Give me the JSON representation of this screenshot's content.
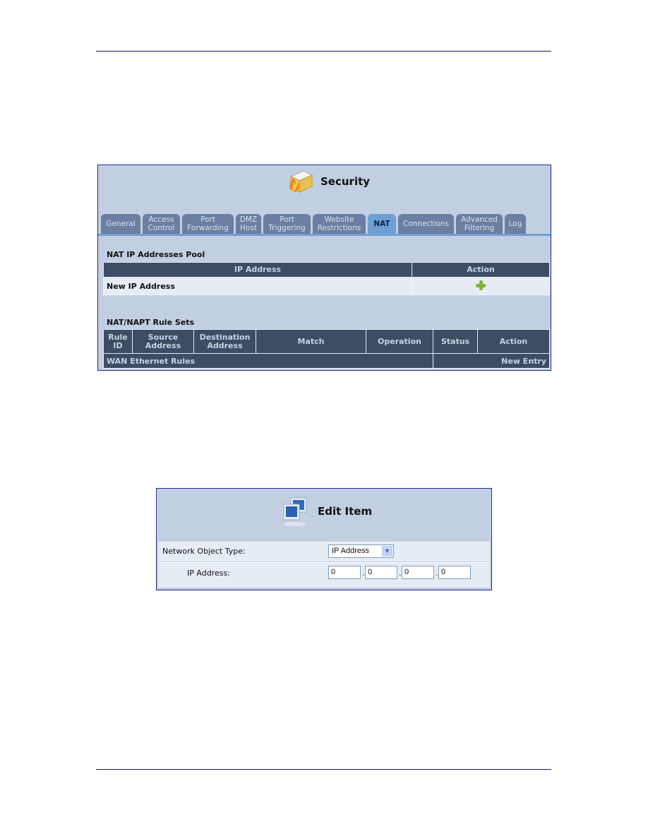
{
  "security": {
    "title": "Security",
    "icon": "firewall-icon",
    "tabs": [
      {
        "label": "General",
        "active": false
      },
      {
        "label": "Access Control",
        "active": false
      },
      {
        "label": "Port Forwarding",
        "active": false
      },
      {
        "label": "DMZ Host",
        "active": false
      },
      {
        "label": "Port Triggering",
        "active": false
      },
      {
        "label": "Website Restrictions",
        "active": false
      },
      {
        "label": "NAT",
        "active": true
      },
      {
        "label": "Connections",
        "active": false
      },
      {
        "label": "Advanced Filtering",
        "active": false
      },
      {
        "label": "Log",
        "active": false
      }
    ],
    "pool": {
      "title": "NAT IP Addresses Pool",
      "columns": [
        "IP Address",
        "Action"
      ],
      "new_row_label": "New IP Address",
      "add_icon": "plus-icon"
    },
    "rules": {
      "title": "NAT/NAPT Rule Sets",
      "columns": [
        "Rule ID",
        "Source Address",
        "Destination Address",
        "Match",
        "Operation",
        "Status",
        "Action"
      ],
      "group_label": "WAN Ethernet Rules",
      "new_entry_label": "New Entry"
    }
  },
  "edit_item": {
    "title": "Edit Item",
    "icon": "network-computers-icon",
    "type_label": "Network Object Type:",
    "type_value": "IP Address",
    "ip_label": "IP Address:",
    "ip_octets": [
      "0",
      "0",
      "0",
      "0"
    ],
    "separator": "."
  }
}
